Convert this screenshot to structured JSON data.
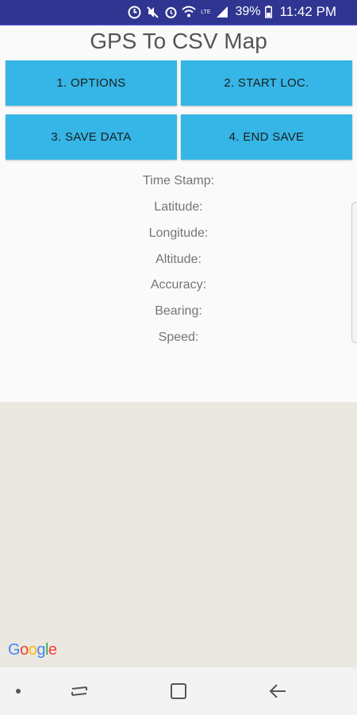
{
  "status_bar": {
    "battery_percent": "39%",
    "time": "11:42 PM",
    "icons": [
      "sync-icon",
      "mute-icon",
      "alarm-icon",
      "wifi-icon",
      "lte-icon",
      "signal-icon",
      "battery-icon"
    ]
  },
  "app": {
    "title": "GPS To CSV Map"
  },
  "buttons": {
    "options": "1. OPTIONS",
    "start_loc": "2. START LOC.",
    "save_data": "3. SAVE DATA",
    "end_save": "4. END SAVE"
  },
  "info": {
    "time_stamp": "Time Stamp:",
    "latitude": "Latitude:",
    "longitude": "Longitude:",
    "altitude": "Altitude:",
    "accuracy": "Accuracy:",
    "bearing": "Bearing:",
    "speed": "Speed:"
  },
  "map": {
    "logo_text": "Google",
    "background_color": "#ebe8e1"
  },
  "colors": {
    "status_bar": "#2f3590",
    "button": "#35b6e6"
  },
  "nav_bar": {
    "icons": [
      "dot-icon",
      "recent-apps-icon",
      "home-icon",
      "back-icon"
    ]
  }
}
